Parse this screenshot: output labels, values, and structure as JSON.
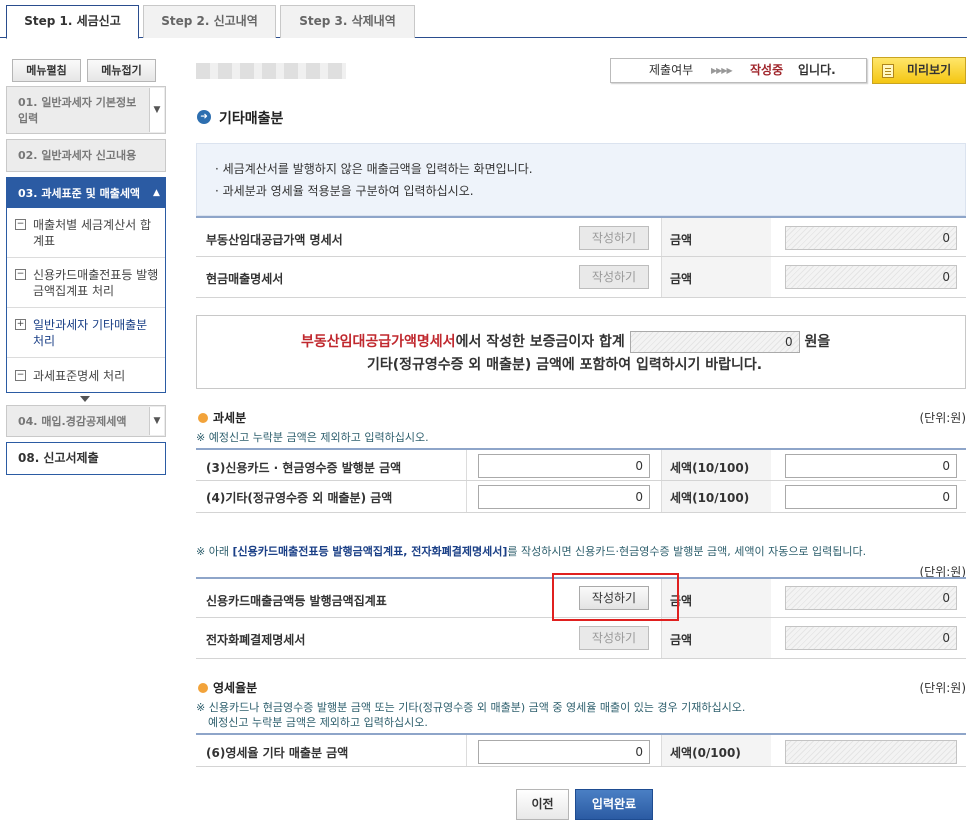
{
  "tabs": [
    "Step 1. 세금신고",
    "Step 2. 신고내역",
    "Step 3. 삭제내역"
  ],
  "sidebar": {
    "edit_menu": "메뉴펼침",
    "collapse_menu": "메뉴접기",
    "items": [
      {
        "label": "01. 일반과세자 기본정보 입력"
      },
      {
        "label": "02. 일반과세자 신고내용"
      },
      {
        "label": "03. 과세표준 및 매출세액"
      },
      {
        "label": "04. 매입.경감공제세액"
      },
      {
        "label": "08. 신고서제출"
      }
    ],
    "subitems": [
      {
        "label": "매출처별 세금계산서 합계표",
        "marker": "−"
      },
      {
        "label": "신용카드매출전표등 발행금액집계표 처리",
        "marker": "−"
      },
      {
        "label": "일반과세자 기타매출분 처리",
        "marker": "+"
      },
      {
        "label": "과세표준명세 처리",
        "marker": "−"
      }
    ]
  },
  "status": {
    "label": "제출여부",
    "arrows": "▶▶▶▶",
    "state": "작성중",
    "suffix": "입니다."
  },
  "preview_button": "미리보기",
  "page_title": "기타매출분",
  "info": [
    "세금계산서를 발행하지 않은 매출금액을 입력하는 화면입니다.",
    "과세분과 영세율 적용분을 구분하여 입력하십시오."
  ],
  "write_label": "작성하기",
  "amount_label": "금액",
  "rows_top": [
    {
      "name": "부동산임대공급가액 명세서",
      "amount": "0"
    },
    {
      "name": "현금매출명세서",
      "amount": "0"
    }
  ],
  "notice": {
    "red": "부동산임대공급가액명세서",
    "line1_mid": "에서 작성한 보증금이자 합계",
    "value": "0",
    "line1_end": "원을",
    "line2": "기타(정규영수증 외 매출분) 금액에 포함하여 입력하시기 바랍니다."
  },
  "taxable": {
    "title": "과세분",
    "unit": "(단위:원)",
    "note": "※ 예정신고 누락분 금액은 제외하고 입력하십시오.",
    "rows": [
      {
        "name": "(3)신용카드 · 현금영수증 발행분 금액",
        "value": "0",
        "tax_label": "세액(10/100)",
        "tax": "0"
      },
      {
        "name": "(4)기타(정규영수증 외 매출분) 금액",
        "value": "0",
        "tax_label": "세액(10/100)",
        "tax": "0"
      }
    ]
  },
  "auto_note": {
    "pre": "※ 아래 ",
    "bold": "[신용카드매출전표등 발행금액집계표, 전자화폐결제명세서]",
    "post": "를 작성하시면 신용카드·현금영수증 발행분 금액, 세액이 자동으로 입력됩니다."
  },
  "unit2": "(단위:원)",
  "rows_mid": [
    {
      "name": "신용카드매출금액등 발행금액집계표",
      "amount": "0"
    },
    {
      "name": "전자화폐결제명세서",
      "amount": "0"
    }
  ],
  "zero_rate": {
    "title": "영세율분",
    "unit": "(단위:원)",
    "note1": "※ 신용카드나 현금영수증 발행분 금액 또는 기타(정규영수증 외 매출분) 금액 중 영세율 매출이 있는 경우 기재하십시오.",
    "note2": "예정신고 누락분 금액은 제외하고 입력하십시오.",
    "row": {
      "name": "(6)영세율 기타 매출분 금액",
      "value": "0",
      "tax_label": "세액(0/100)"
    }
  },
  "buttons": {
    "prev": "이전",
    "done": "입력완료"
  }
}
